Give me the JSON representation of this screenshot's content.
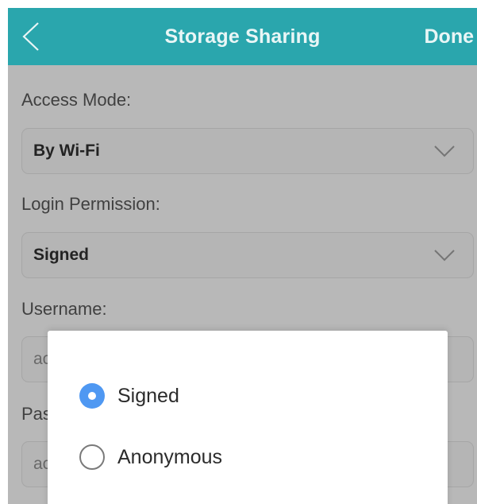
{
  "header": {
    "title": "Storage Sharing",
    "done_label": "Done"
  },
  "access_mode": {
    "label": "Access Mode:",
    "value": "By Wi-Fi"
  },
  "login_permission": {
    "label": "Login Permission:",
    "value": "Signed"
  },
  "username": {
    "label": "Username:",
    "partial_value": "ac"
  },
  "password": {
    "label_partial": "Pas",
    "partial_value": "ac"
  },
  "dialog": {
    "options": [
      {
        "label": "Signed",
        "selected": true
      },
      {
        "label": "Anonymous",
        "selected": false
      }
    ]
  },
  "colors": {
    "header_bg": "#2aa6ad",
    "radio_selected": "#4f98f2"
  },
  "icons": {
    "back": "chevron-left-icon",
    "dropdown": "chevron-down-icon"
  }
}
